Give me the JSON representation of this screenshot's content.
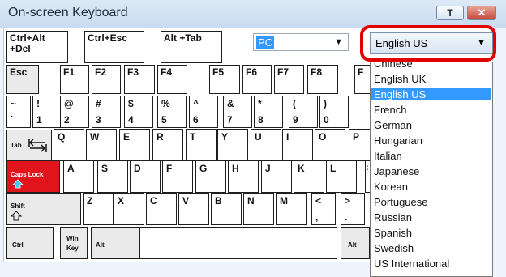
{
  "window": {
    "title": "On-screen Keyboard",
    "help_label": "T",
    "close_label": "✕"
  },
  "top_row": {
    "ctrl_alt_del_1": "Ctrl+Alt",
    "ctrl_alt_del_2": "+Del",
    "ctrl_esc": "Ctrl+Esc",
    "alt_tab": "Alt +Tab"
  },
  "platform_combo": {
    "value": "PC",
    "arrow": "▼"
  },
  "language_combo": {
    "value": "English US",
    "arrow": "▼"
  },
  "language_options": [
    "Chinese",
    "English UK",
    "English US",
    "French",
    "German",
    "Hungarian",
    "Italian",
    "Japanese",
    "Korean",
    "Portuguese",
    "Russian",
    "Spanish",
    "Swedish",
    "US International"
  ],
  "selected_language": "English US",
  "fkeys": {
    "esc": "Esc",
    "f1": "F1",
    "f2": "F2",
    "f3": "F3",
    "f4": "F4",
    "f5": "F5",
    "f6": "F6",
    "f7": "F7",
    "f8": "F8",
    "f9_partial": "F"
  },
  "number_row": [
    {
      "top": "~",
      "bottom": "`"
    },
    {
      "top": "!",
      "bottom": "1"
    },
    {
      "top": "@",
      "bottom": "2"
    },
    {
      "top": "#",
      "bottom": "3"
    },
    {
      "top": "$",
      "bottom": "4"
    },
    {
      "top": "%",
      "bottom": "5"
    },
    {
      "top": "^",
      "bottom": "6"
    },
    {
      "top": "&",
      "bottom": "7"
    },
    {
      "top": "*",
      "bottom": "8"
    },
    {
      "top": "(",
      "bottom": "9"
    },
    {
      "top": ")",
      "bottom": "0"
    }
  ],
  "qwerty_row": {
    "tab": "Tab",
    "keys": [
      "Q",
      "W",
      "E",
      "R",
      "T",
      "Y",
      "U",
      "I",
      "O",
      "P"
    ]
  },
  "home_row": {
    "caps": "Caps Lock",
    "keys": [
      "A",
      "S",
      "D",
      "F",
      "G",
      "H",
      "J",
      "K",
      "L"
    ],
    "partial": ":"
  },
  "shift_row": {
    "shift": "Shift",
    "keys": [
      "Z",
      "X",
      "C",
      "V",
      "B",
      "N",
      "M"
    ],
    "lt": "<",
    "lt_b": ",",
    "gt": ">",
    "gt_b": "."
  },
  "bottom_row": {
    "ctrl": "Ctrl",
    "win_1": "Win",
    "win_2": "Key",
    "alt_left": "Alt",
    "alt_right": "Alt"
  }
}
